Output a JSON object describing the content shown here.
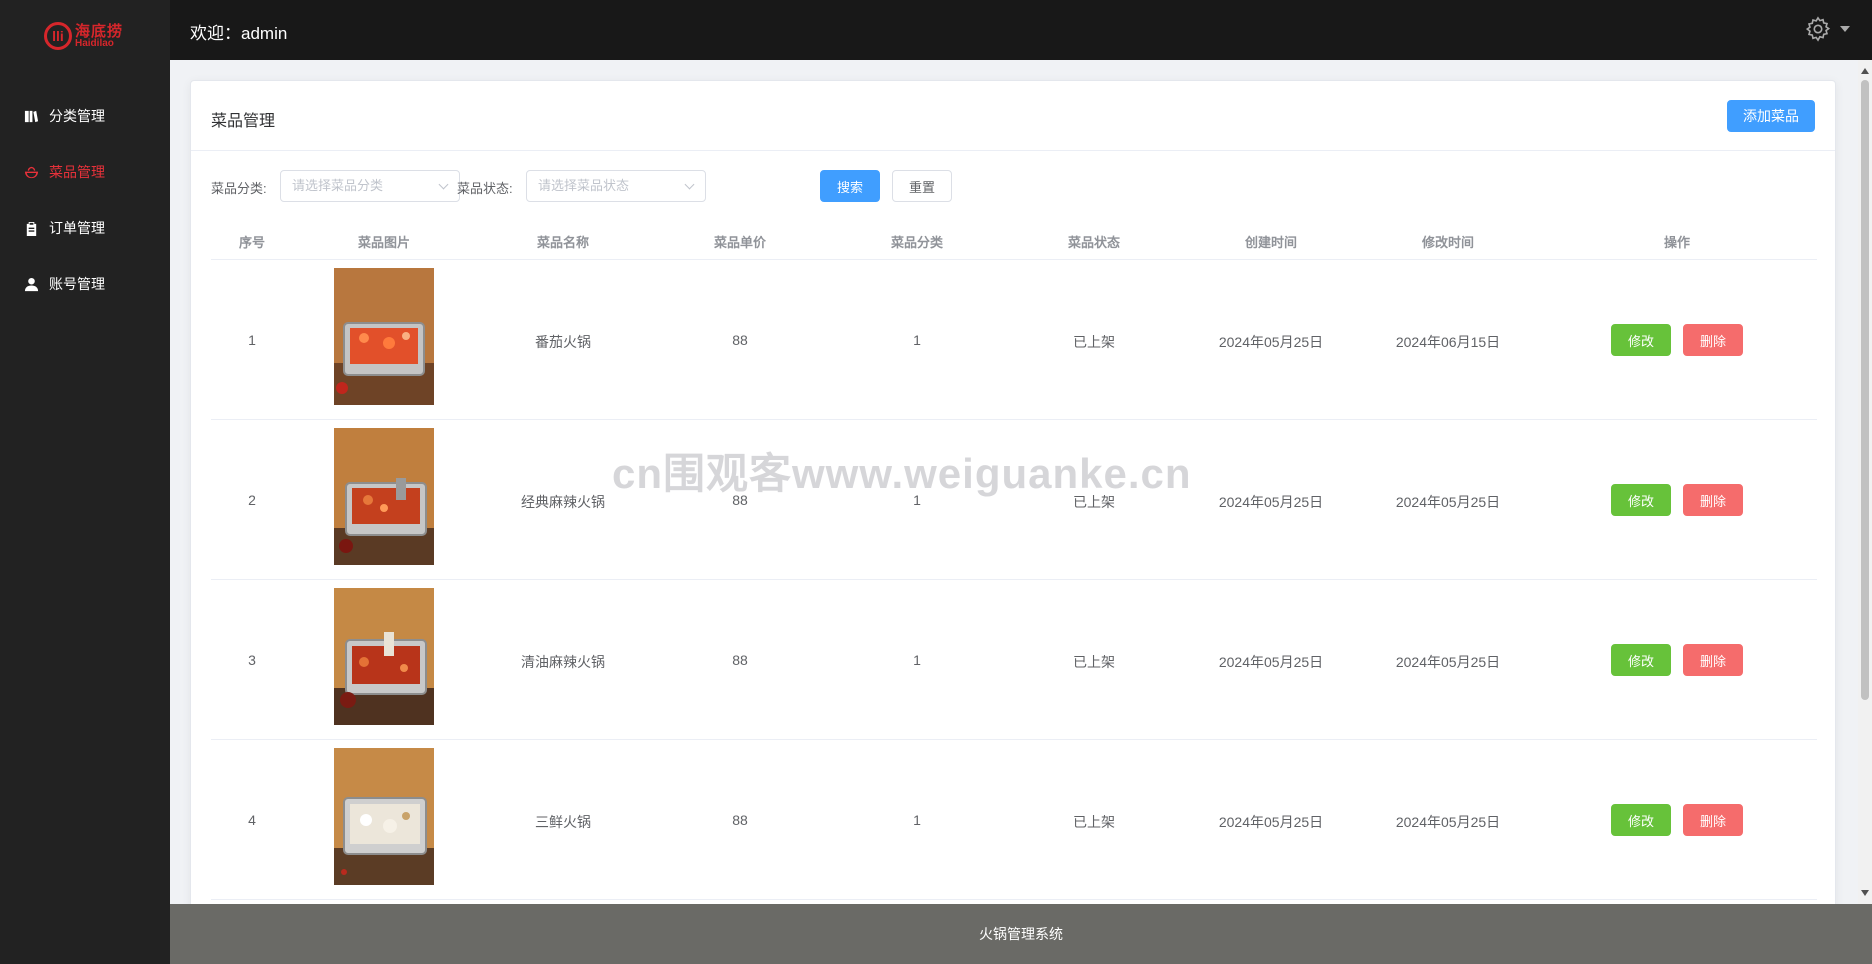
{
  "brand": {
    "name_cn": "海底捞",
    "name_en": "Haidilao"
  },
  "sidebar": {
    "items": [
      {
        "label": "分类管理",
        "icon": "book-icon"
      },
      {
        "label": "菜品管理",
        "icon": "bowl-icon",
        "active": true
      },
      {
        "label": "订单管理",
        "icon": "clipboard-icon"
      },
      {
        "label": "账号管理",
        "icon": "user-icon"
      }
    ]
  },
  "header": {
    "welcome": "欢迎：admin",
    "settings_icon": "gear-icon"
  },
  "card": {
    "title": "菜品管理",
    "add_label": "添加菜品"
  },
  "filters": {
    "category_label": "菜品分类:",
    "category_placeholder": "请选择菜品分类",
    "status_label": "菜品状态:",
    "status_placeholder": "请选择菜品状态",
    "search_label": "搜索",
    "reset_label": "重置"
  },
  "table": {
    "columns": [
      "序号",
      "菜品图片",
      "菜品名称",
      "菜品单价",
      "菜品分类",
      "菜品状态",
      "创建时间",
      "修改时间",
      "操作"
    ],
    "rows": [
      {
        "index": "1",
        "name": "番茄火锅",
        "price": "88",
        "category": "1",
        "status": "已上架",
        "created": "2024年05月25日",
        "modified": "2024年06月15日"
      },
      {
        "index": "2",
        "name": "经典麻辣火锅",
        "price": "88",
        "category": "1",
        "status": "已上架",
        "created": "2024年05月25日",
        "modified": "2024年05月25日"
      },
      {
        "index": "3",
        "name": "清油麻辣火锅",
        "price": "88",
        "category": "1",
        "status": "已上架",
        "created": "2024年05月25日",
        "modified": "2024年05月25日"
      },
      {
        "index": "4",
        "name": "三鲜火锅",
        "price": "88",
        "category": "1",
        "status": "已上架",
        "created": "2024年05月25日",
        "modified": "2024年05月25日"
      }
    ],
    "edit_label": "修改",
    "delete_label": "删除"
  },
  "footer": {
    "text": "火锅管理系统"
  },
  "watermark": "cn围观客www.weiguanke.cn",
  "colors": {
    "sidebar_bg": "#222222",
    "active": "#e8313a",
    "primary": "#409eff",
    "success": "#67c23a",
    "danger": "#f56c6c"
  }
}
